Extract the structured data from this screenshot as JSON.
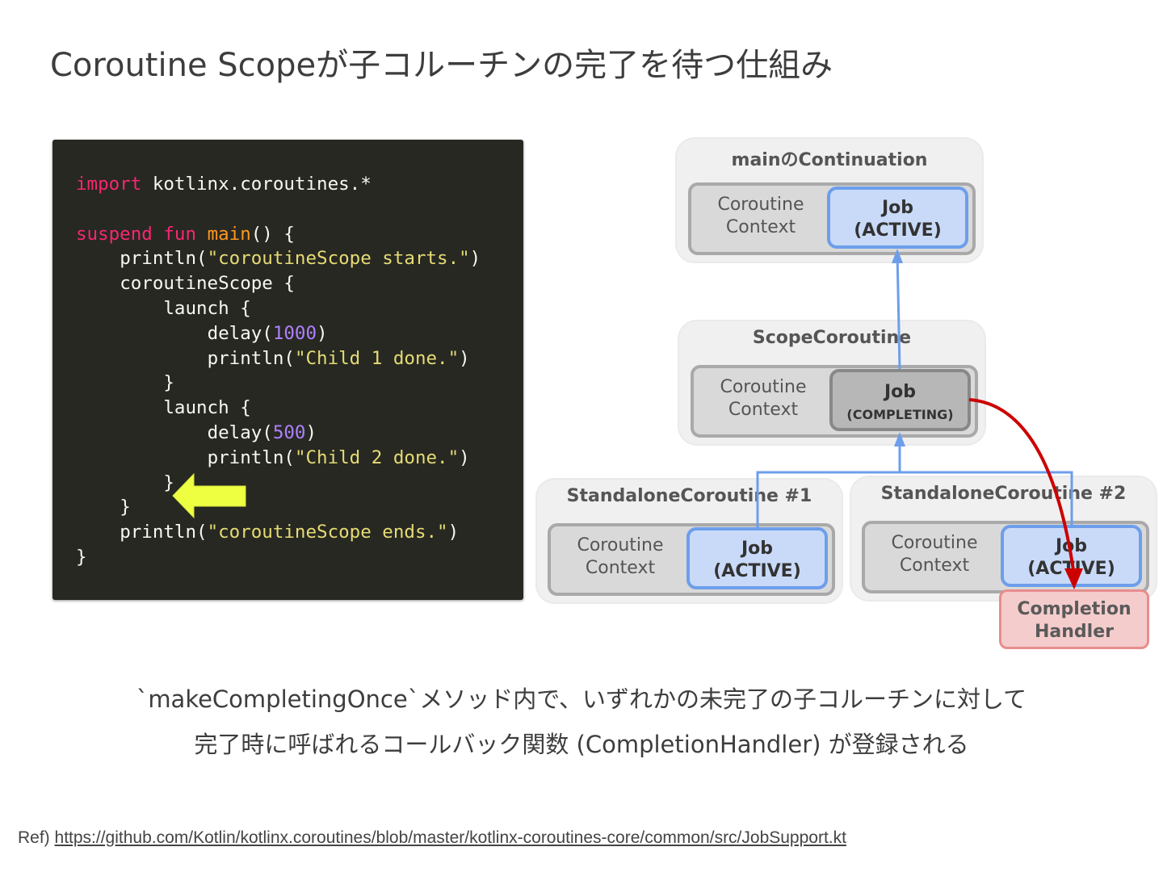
{
  "title": "Coroutine Scopeが子コルーチンの完了を待つ仕組み",
  "code": {
    "line1_kw": "import",
    "line1_rest": " kotlinx.coroutines.*",
    "line2_kw1": "suspend",
    "line2_kw2": "fun",
    "line2_fn": "main",
    "line2_rest": "() {",
    "println1": "println(",
    "str1": "\"coroutineScope starts.\"",
    "scope_open": "coroutineScope {",
    "launch1": "launch {",
    "delay1": "delay(",
    "num1": "1000",
    "println_child": "println(",
    "str_child1": "\"Child 1 done.\"",
    "launch2": "launch {",
    "delay2": "delay(",
    "num2": "500",
    "str_child2": "\"Child 2 done.\"",
    "str_end": "\"coroutineScope ends.\"",
    "close_paren": ")",
    "close_brace": "}"
  },
  "diagram": {
    "main": {
      "label": "mainのContinuation",
      "context_line1": "Coroutine",
      "context_line2": "Context",
      "job_line1": "Job",
      "job_line2": "(ACTIVE)"
    },
    "scope": {
      "label": "ScopeCoroutine",
      "context_line1": "Coroutine",
      "context_line2": "Context",
      "job_line1": "Job",
      "job_line2": "(COMPLETING)"
    },
    "child1": {
      "label": "StandaloneCoroutine #1",
      "context_line1": "Coroutine",
      "context_line2": "Context",
      "job_line1": "Job",
      "job_line2": "(ACTIVE)"
    },
    "child2": {
      "label": "StandaloneCoroutine #2",
      "context_line1": "Coroutine",
      "context_line2": "Context",
      "job_line1": "Job",
      "job_line2": "(ACTIVE)"
    },
    "handler_line1": "Completion",
    "handler_line2": "Handler",
    "colors": {
      "active_fill": "#c9daf8",
      "active_border": "#6d9eeb",
      "completing_fill": "#b7b7b7",
      "handler_fill": "#f4cccc",
      "handler_border": "#e88d8d",
      "red_arrow": "#cc0000",
      "yellow_arrow": "#eeff41"
    }
  },
  "caption": {
    "line1": "`makeCompletingOnce`メソッド内で、いずれかの未完了の子コルーチンに対して",
    "line2": "完了時に呼ばれるコールバック関数 (CompletionHandler) が登録される"
  },
  "ref": {
    "prefix": "Ref)",
    "url": "https://github.com/Kotlin/kotlinx.coroutines/blob/master/kotlinx-coroutines-core/common/src/JobSupport.kt"
  }
}
